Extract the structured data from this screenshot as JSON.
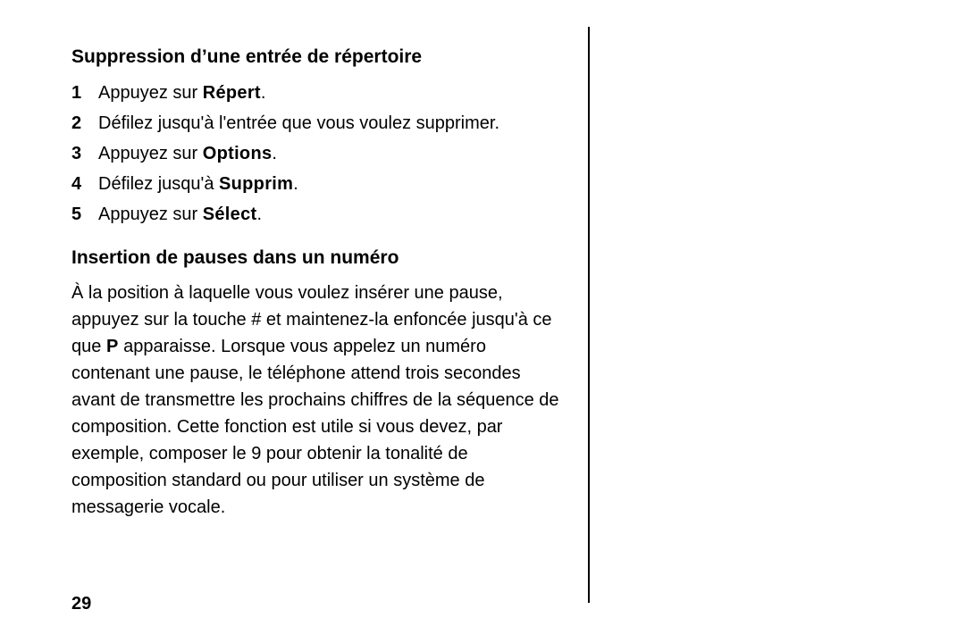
{
  "section1": {
    "heading": "Suppression d’une entrée de répertoire",
    "steps": [
      {
        "n": "1",
        "pre": "Appuyez sur ",
        "kw": "Répert",
        "post": "."
      },
      {
        "n": "2",
        "pre": "Défilez jusqu'à l'entrée que vous voulez supprimer.",
        "kw": "",
        "post": ""
      },
      {
        "n": "3",
        "pre": "Appuyez sur ",
        "kw": "Options",
        "post": "."
      },
      {
        "n": "4",
        "pre": "Défilez jusqu'à ",
        "kw": "Supprim",
        "post": "."
      },
      {
        "n": "5",
        "pre": "Appuyez sur ",
        "kw": "Sélect",
        "post": "."
      }
    ]
  },
  "section2": {
    "heading": "Insertion de pauses dans un numéro",
    "para_pre": "À la position à laquelle vous voulez insérer une pause, appuyez sur la touche # et maintenez-la enfoncée jusqu'à ce que ",
    "para_kw": "P",
    "para_post": " apparaisse. Lorsque vous appelez un numéro contenant une pause, le téléphone attend trois secondes avant de transmettre les prochains chiffres de la séquence de composition. Cette fonction est utile si vous devez, par exemple, composer le 9 pour obtenir la tonalité de composition standard ou pour utiliser un système de messagerie vocale."
  },
  "page_number": "29"
}
